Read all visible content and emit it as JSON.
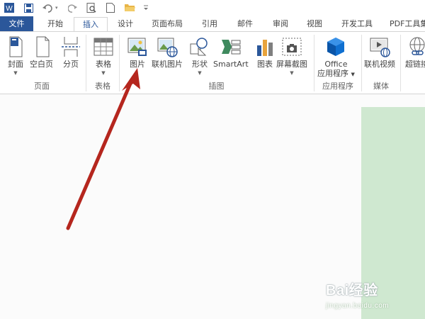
{
  "quick_access": {
    "app_icon": "word-icon",
    "save_icon": "save-icon",
    "undo_icon": "undo-icon",
    "redo_icon": "redo-icon",
    "print_preview_icon": "print-preview-icon",
    "new_icon": "new-document-icon",
    "open_icon": "open-folder-icon",
    "customize_icon": "customize-caret-icon"
  },
  "tabs": [
    "文件",
    "开始",
    "插入",
    "设计",
    "页面布局",
    "引用",
    "邮件",
    "审阅",
    "视图",
    "开发工具",
    "PDF工具集"
  ],
  "active_tab": "插入",
  "ribbon": {
    "pages": {
      "cover": "封面",
      "blank": "空白页",
      "break": "分页",
      "group": "页面"
    },
    "tables": {
      "table": "表格",
      "group": "表格"
    },
    "illustrations": {
      "picture": "图片",
      "online_picture": "联机图片",
      "shapes": "形状",
      "smartart": "SmartArt",
      "chart": "图表",
      "screenshot": "屏幕截图",
      "group": "插图"
    },
    "addins": {
      "office_line1": "Office",
      "office_line2": "应用程序",
      "group": "应用程序"
    },
    "media": {
      "online_video": "联机视频",
      "group": "媒体"
    },
    "links": {
      "hyperlink": "超链接"
    }
  },
  "watermark": {
    "brand": "Bai经验",
    "url": "jingyan.baidu.com"
  },
  "colors": {
    "file_tab": "#2b579a",
    "accent": "#2b579a",
    "page": "#cfe8d0",
    "arrow": "#b5261e"
  }
}
